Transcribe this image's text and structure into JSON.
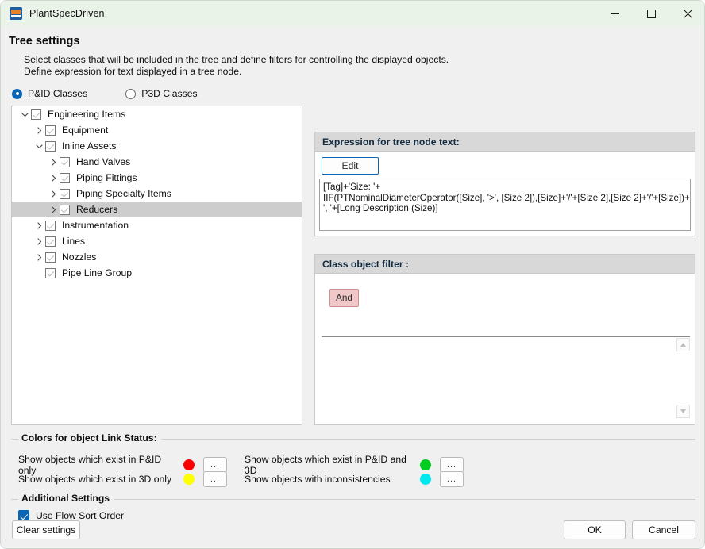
{
  "window": {
    "title": "PlantSpecDriven",
    "icon": "app-icon",
    "minimize": "minimize-icon",
    "maximize": "maximize-icon",
    "close": "close-icon"
  },
  "page": {
    "title": "Tree settings",
    "description": "Select classes that will be included in the tree and define filters for controlling the displayed objects.\nDefine expression for text displayed in a tree node."
  },
  "class_mode": {
    "options": [
      {
        "label": "P&ID Classes",
        "selected": true
      },
      {
        "label": "P3D Classes",
        "selected": false
      }
    ]
  },
  "tree": {
    "nodes": [
      {
        "label": "Engineering Items",
        "indent": 0,
        "twisty": "expanded",
        "checked": true,
        "selected": false
      },
      {
        "label": "Equipment",
        "indent": 1,
        "twisty": "collapsed",
        "checked": true,
        "selected": false
      },
      {
        "label": "Inline Assets",
        "indent": 1,
        "twisty": "expanded",
        "checked": true,
        "selected": false
      },
      {
        "label": "Hand Valves",
        "indent": 2,
        "twisty": "collapsed",
        "checked": true,
        "selected": false
      },
      {
        "label": "Piping Fittings",
        "indent": 2,
        "twisty": "collapsed",
        "checked": true,
        "selected": false
      },
      {
        "label": "Piping Specialty Items",
        "indent": 2,
        "twisty": "collapsed",
        "checked": true,
        "selected": false
      },
      {
        "label": "Reducers",
        "indent": 2,
        "twisty": "collapsed",
        "checked": true,
        "selected": true
      },
      {
        "label": "Instrumentation",
        "indent": 1,
        "twisty": "collapsed",
        "checked": true,
        "selected": false
      },
      {
        "label": "Lines",
        "indent": 1,
        "twisty": "collapsed",
        "checked": true,
        "selected": false
      },
      {
        "label": "Nozzles",
        "indent": 1,
        "twisty": "collapsed",
        "checked": true,
        "selected": false
      },
      {
        "label": "Pipe Line Group",
        "indent": 1,
        "twisty": "none",
        "checked": true,
        "selected": false
      }
    ]
  },
  "expression": {
    "header": "Expression for tree node text:",
    "edit_label": "Edit",
    "value": "[Tag]+'Size: '+\nIIF(PTNominalDiameterOperator([Size], '>', [Size 2]),[Size]+'/'+[Size 2],[Size 2]+'/'+[Size])+\n', '+[Long Description (Size)]"
  },
  "filter": {
    "header": "Class object filter :",
    "chip": "And"
  },
  "colors": {
    "legend": "Colors for object Link Status:",
    "rows": [
      {
        "label": "Show objects which exist in P&ID only",
        "color": "#ff0000",
        "button": "..."
      },
      {
        "label": "Show objects which exist in 3D only",
        "color": "#ffff00",
        "button": "..."
      },
      {
        "label": "Show objects which exist in P&ID and 3D",
        "color": "#00cc22",
        "button": "..."
      },
      {
        "label": "Show objects with inconsistencies",
        "color": "#00e8f0",
        "button": "..."
      }
    ]
  },
  "additional": {
    "legend": "Additional Settings",
    "flow_sort_label": "Use Flow Sort Order",
    "flow_sort_checked": true
  },
  "footer": {
    "clear": "Clear settings",
    "ok": "OK",
    "cancel": "Cancel"
  }
}
